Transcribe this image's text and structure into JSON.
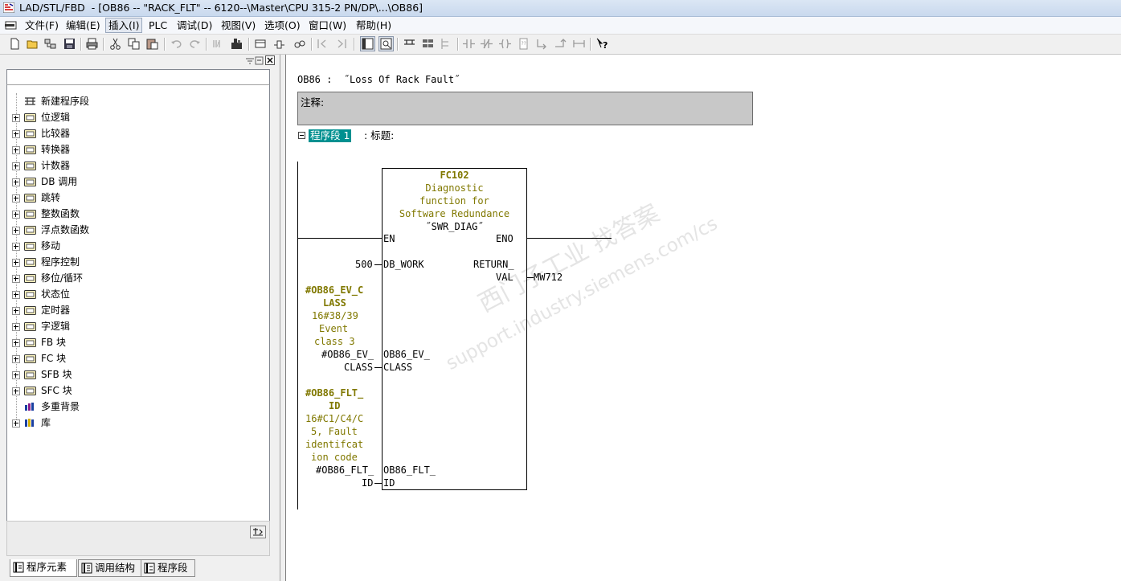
{
  "window": {
    "title": "LAD/STL/FBD  - [OB86 -- \"RACK_FLT\" -- 6120--\\Master\\CPU 315-2 PN/DP\\...\\OB86]"
  },
  "menu": {
    "items": [
      {
        "label": "文件(F)"
      },
      {
        "label": "编辑(E)"
      },
      {
        "label": "插入(I)"
      },
      {
        "label": "PLC"
      },
      {
        "label": "调试(D)"
      },
      {
        "label": "视图(V)"
      },
      {
        "label": "选项(O)"
      },
      {
        "label": "窗口(W)"
      },
      {
        "label": "帮助(H)"
      }
    ]
  },
  "toolbar": {
    "icons": [
      "new-icon",
      "open-icon",
      "accessible-nodes-icon",
      "save-icon",
      "print-icon",
      "cut-icon",
      "copy-icon",
      "paste-icon",
      "undo-icon",
      "redo-icon",
      "monitor-icon",
      "module-info-icon",
      "window-icon",
      "network-icon",
      "network-rename-icon",
      "nav-back-icon",
      "nav-forward-icon",
      "overview-icon",
      "details-icon",
      "rung-branch-icon",
      "table-icon",
      "contact-no-icon",
      "contact-nc-icon",
      "coil-icon",
      "box-icon",
      "branch-open-icon",
      "branch-close-icon",
      "connection-icon",
      "help-icon"
    ]
  },
  "program_elements": {
    "items": [
      {
        "label": "新建程序段",
        "icon": "new-network-icon",
        "expandable": false
      },
      {
        "label": "位逻辑",
        "icon": "bit-logic-icon",
        "expandable": true
      },
      {
        "label": "比较器",
        "icon": "comparator-icon",
        "expandable": true
      },
      {
        "label": "转换器",
        "icon": "converter-icon",
        "expandable": true
      },
      {
        "label": "计数器",
        "icon": "counter-icon",
        "expandable": true
      },
      {
        "label": "DB 调用",
        "icon": "db-call-icon",
        "expandable": true
      },
      {
        "label": "跳转",
        "icon": "jump-icon",
        "expandable": true
      },
      {
        "label": "整数函数",
        "icon": "integer-math-icon",
        "expandable": true
      },
      {
        "label": "浮点数函数",
        "icon": "float-math-icon",
        "expandable": true
      },
      {
        "label": "移动",
        "icon": "move-icon",
        "expandable": true
      },
      {
        "label": "程序控制",
        "icon": "program-control-icon",
        "expandable": true
      },
      {
        "label": "移位/循环",
        "icon": "shift-rotate-icon",
        "expandable": true
      },
      {
        "label": "状态位",
        "icon": "status-bits-icon",
        "expandable": true
      },
      {
        "label": "定时器",
        "icon": "timer-icon",
        "expandable": true
      },
      {
        "label": "字逻辑",
        "icon": "word-logic-icon",
        "expandable": true
      },
      {
        "label": "FB 块",
        "icon": "fb-block-icon",
        "expandable": true
      },
      {
        "label": "FC 块",
        "icon": "fc-block-icon",
        "expandable": true
      },
      {
        "label": "SFB 块",
        "icon": "sfb-block-icon",
        "expandable": true
      },
      {
        "label": "SFC 块",
        "icon": "sfc-block-icon",
        "expandable": true
      },
      {
        "label": "多重背景",
        "icon": "multi-instance-icon",
        "expandable": false
      },
      {
        "label": "库",
        "icon": "library-icon",
        "expandable": true
      }
    ],
    "tabs": [
      {
        "label": "程序元素",
        "icon": "program-elements-icon"
      },
      {
        "label": "调用结构",
        "icon": "call-structure-icon"
      },
      {
        "label": "程序段",
        "icon": "networks-icon"
      }
    ]
  },
  "block": {
    "header": "OB86 :  ˝Loss Of Rack Fault˝",
    "comment_label": "注释:",
    "network_title": "程序段 1",
    "network_suffix": ": 标题:"
  },
  "fc_box": {
    "name": "FC102",
    "desc": [
      "Diagnostic",
      "function for",
      "Software Redundance",
      "˝SWR_DIAG˝"
    ],
    "pin_en": "EN",
    "pin_eno": "ENO",
    "pin_db_work": "DB_WORK",
    "val_db_work": "500",
    "pin_return_1": "RETURN_",
    "pin_return_2": "VAL",
    "val_return": "MW712",
    "pin_ev_class_1": "OB86_EV_",
    "pin_ev_class_2": "CLASS",
    "ev_class_sym_1": "#OB86_EV_C",
    "ev_class_sym_2": "LASS",
    "ev_class_cmt": [
      "16#38/39",
      "Event",
      "class 3"
    ],
    "ev_class_op_1": "#OB86_EV_",
    "ev_class_op_2": "CLASS",
    "pin_flt_id_1": "OB86_FLT_",
    "pin_flt_id_2": "ID",
    "flt_id_sym_1": "#OB86_FLT_",
    "flt_id_sym_2": "ID",
    "flt_id_cmt": [
      "16#C1/C4/C",
      "5, Fault",
      "identifcat",
      "ion code"
    ],
    "flt_id_op_1": "#OB86_FLT_",
    "flt_id_op_2": "ID"
  },
  "watermark": {
    "line1": "西门子工业  找答案",
    "line2": "support.industry.siemens.com/cs"
  }
}
